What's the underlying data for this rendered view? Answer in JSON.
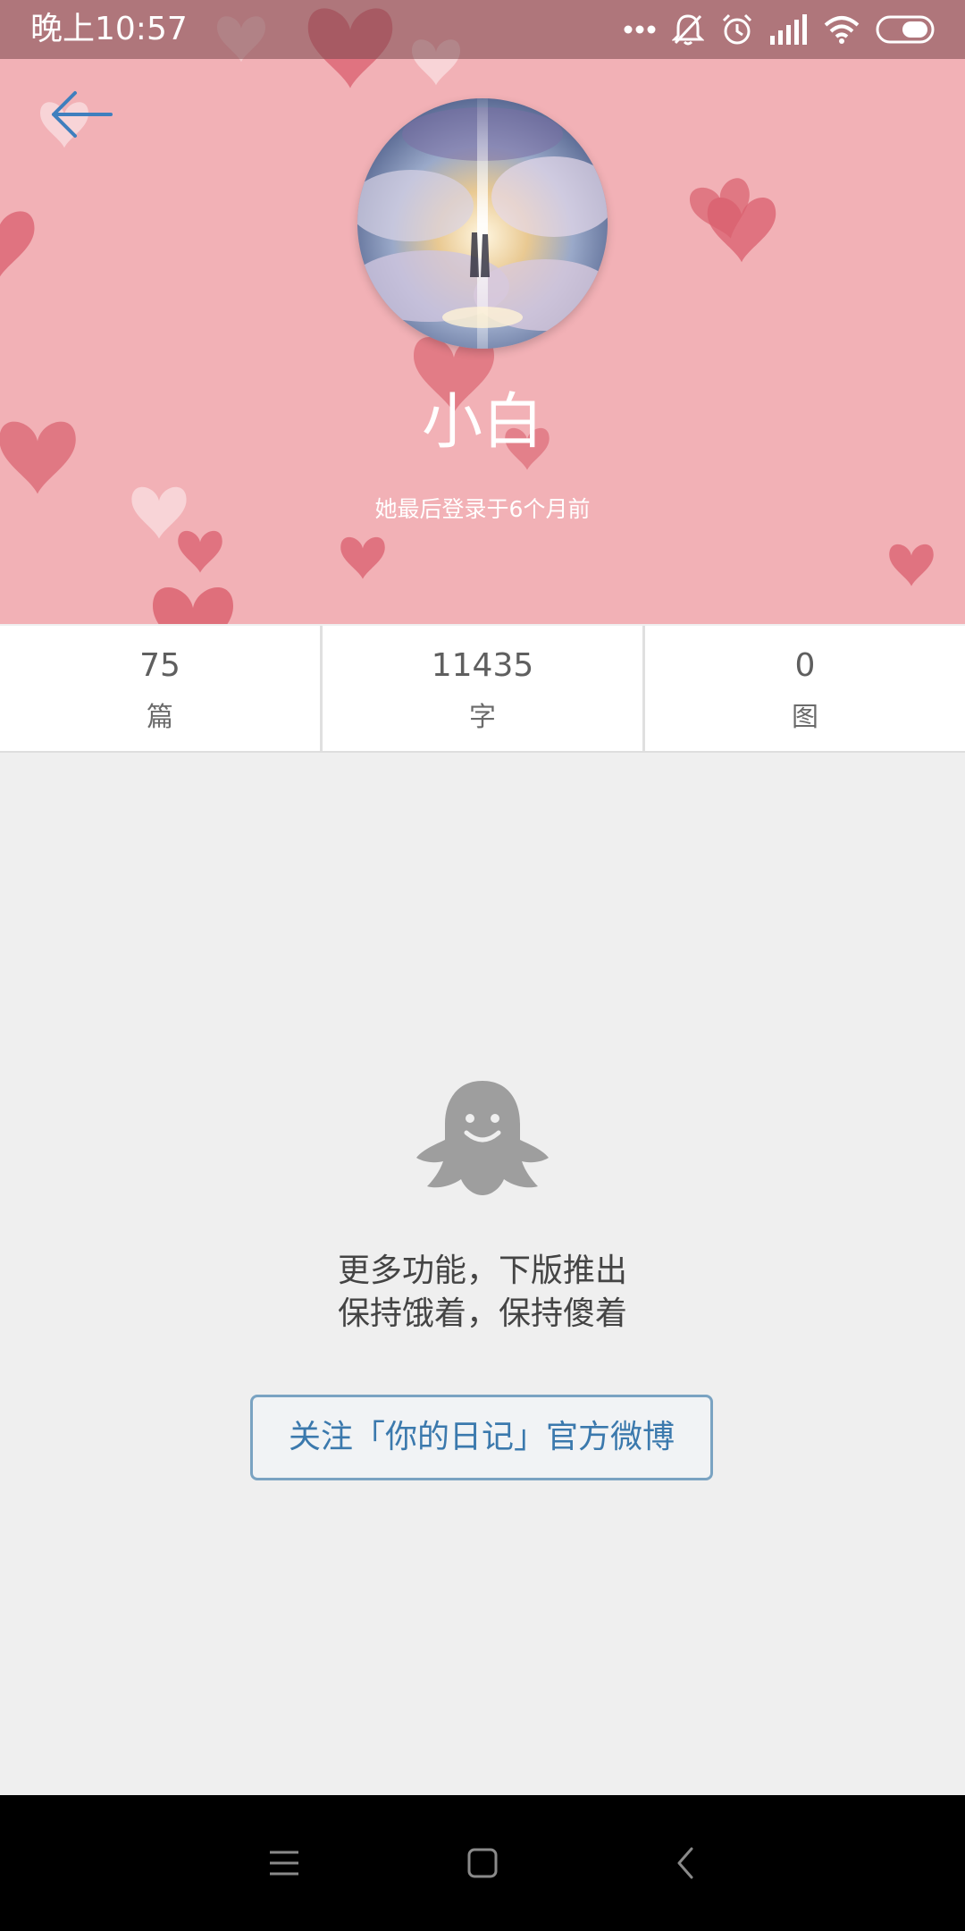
{
  "status_bar": {
    "time": "晚上10:57",
    "icons": [
      "more-dots-icon",
      "mute-icon",
      "alarm-icon",
      "signal-icon",
      "wifi-icon",
      "battery-icon"
    ]
  },
  "header": {
    "back_icon": "arrow-left-icon",
    "avatar_alt": "avatar",
    "username": "小白",
    "last_login": "她最后登录于6个月前",
    "background_color": "#f2b1b6",
    "heart_color": "#e2727f"
  },
  "stats": [
    {
      "value": "75",
      "label": "篇"
    },
    {
      "value": "11435",
      "label": "字"
    },
    {
      "value": "0",
      "label": "图"
    }
  ],
  "empty_state": {
    "icon": "ghost-icon",
    "line1": "更多功能，下版推出",
    "line2": "保持饿着，保持傻着"
  },
  "follow_button": {
    "label": "关注「你的日记」官方微博",
    "color": "#3b79ad"
  },
  "nav_bar": {
    "icons": [
      "menu-icon",
      "home-square-icon",
      "back-chevron-icon"
    ]
  }
}
